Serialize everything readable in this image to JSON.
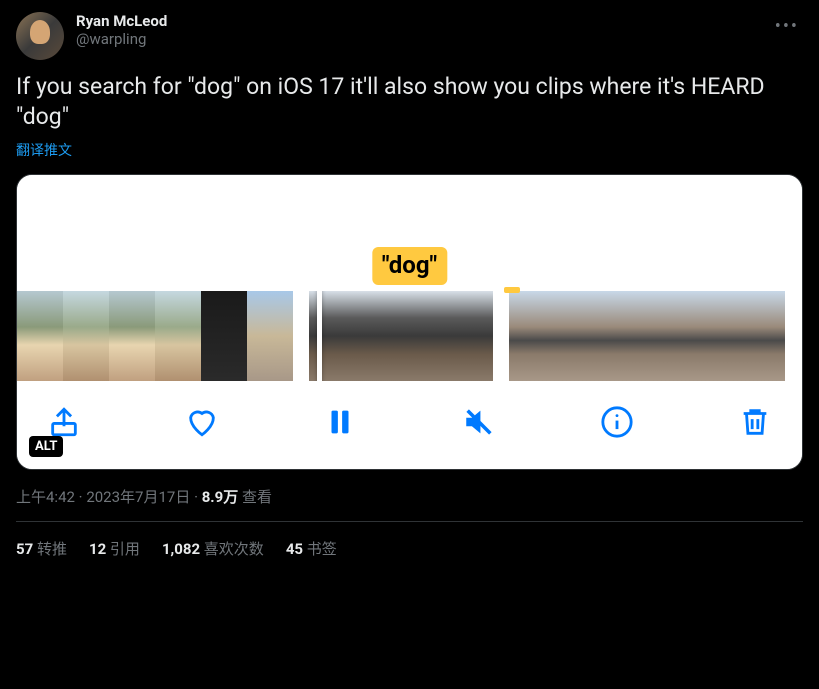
{
  "author": {
    "display_name": "Ryan McLeod",
    "handle": "@warpling"
  },
  "tweet_text": "If you search for \"dog\" on iOS 17 it'll also show you clips where it's HEARD \"dog\"",
  "translate_label": "翻译推文",
  "media": {
    "badge_text": "\"dog\"",
    "alt_label": "ALT",
    "toolbar": {
      "share": "share",
      "like": "like",
      "pause": "pause",
      "mute": "mute",
      "info": "info",
      "delete": "delete"
    }
  },
  "meta": {
    "time": "上午4:42",
    "date": "2023年7月17日",
    "views_count": "8.9万",
    "views_label": "查看"
  },
  "stats": {
    "retweets_count": "57",
    "retweets_label": "转推",
    "quotes_count": "12",
    "quotes_label": "引用",
    "likes_count": "1,082",
    "likes_label": "喜欢次数",
    "bookmarks_count": "45",
    "bookmarks_label": "书签"
  }
}
